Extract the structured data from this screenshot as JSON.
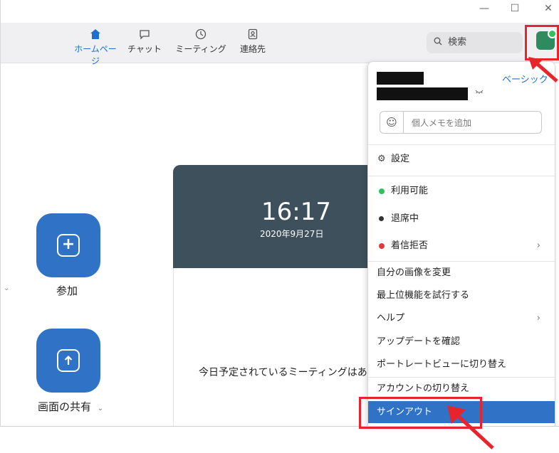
{
  "window": {
    "minimize": "—",
    "maximize": "☐",
    "close": "✕"
  },
  "nav": {
    "items": [
      {
        "label": "ホームページ",
        "icon": "home-icon"
      },
      {
        "label": "チャット",
        "icon": "chat-icon"
      },
      {
        "label": "ミーティング",
        "icon": "clock-icon"
      },
      {
        "label": "連絡先",
        "icon": "contacts-icon"
      }
    ],
    "search_placeholder": "検索"
  },
  "home": {
    "join_label": "参加",
    "share_label": "画面の共有",
    "time": "16:17",
    "date": "2020年9月27日",
    "no_meetings": "今日予定されているミーティングはありません"
  },
  "profile_menu": {
    "plan": "ベーシック",
    "memo_placeholder": "個人メモを追加",
    "settings": "設定",
    "status_available": "利用可能",
    "status_away": "退席中",
    "status_dnd": "着信拒否",
    "change_picture": "自分の画像を変更",
    "try_top_features": "最上位機能を試行する",
    "help": "ヘルプ",
    "check_updates": "アップデートを確認",
    "portrait_view": "ポートレートビューに切り替え",
    "switch_account": "アカウントの切り替え",
    "sign_out": "サインアウト"
  },
  "colors": {
    "accent": "#2f72c6",
    "highlight_box": "#e7242b",
    "available": "#30c060",
    "dnd": "#e0383e"
  }
}
